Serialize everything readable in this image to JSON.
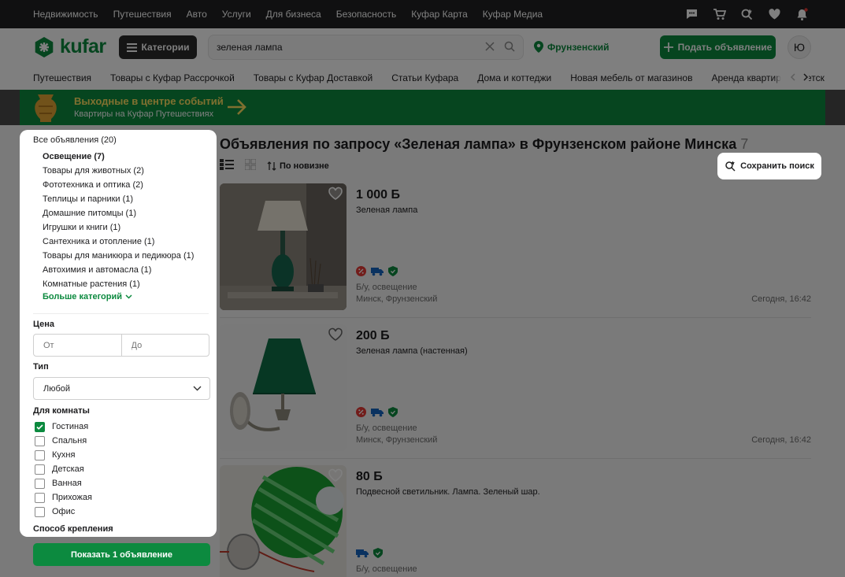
{
  "topnav": {
    "links": [
      "Недвижимость",
      "Путешествия",
      "Авто",
      "Услуги",
      "Для бизнеса",
      "Безопасность",
      "Куфар Карта",
      "Куфар Медиа"
    ],
    "icons": [
      "chat-icon",
      "cart-icon",
      "saved-search-icon",
      "heart-icon",
      "bell-icon"
    ]
  },
  "header": {
    "logo": "kufar",
    "categories_label": "Категории",
    "search_value": "зеленая лампа",
    "location": "Фрунзенский",
    "post_label": "Подать объявление",
    "avatar_letter": "Ю"
  },
  "catrow": [
    "Путешествия",
    "Товары с Куфар Рассрочкой",
    "Товары с Куфар Доставкой",
    "Статьи Куфара",
    "Дома и коттеджи",
    "Новая мебель от магазинов",
    "Аренда квартир",
    "Детск"
  ],
  "banner": {
    "title": "Выходные в центре событий",
    "subtitle": "Квартиры на Куфар Путешествиях"
  },
  "results": {
    "title": "Объявления по запросу «Зеленая лампа» в Фрунзенском районе Минска",
    "count": "7",
    "sort_label": "По новизне",
    "save_search_label": "Сохранить поиск"
  },
  "listings": [
    {
      "price": "1 000 Б",
      "title": "Зеленая лампа",
      "condition": "Б/у, освещение",
      "location": "Минск, Фрунзенский",
      "date": "Сегодня, 16:42"
    },
    {
      "price": "200 Б",
      "title": "Зеленая лампа (настенная)",
      "condition": "Б/у, освещение",
      "location": "Минск, Фрунзенский",
      "date": "Сегодня, 16:42"
    },
    {
      "price": "80 Б",
      "title": "Подвесной светильник. Лампа. Зеленый шар.",
      "condition": "Б/у, освещение",
      "location": "",
      "date": ""
    }
  ],
  "filter": {
    "all_label": "Все объявления (20)",
    "categories": [
      "Освещение (7)",
      "Товары для животных (2)",
      "Фототехника и оптика (2)",
      "Теплицы и парники (1)",
      "Домашние питомцы (1)",
      "Игрушки и книги (1)",
      "Сантехника и отопление (1)",
      "Товары для маникюра и педикюра (1)",
      "Автохимия и автомасла (1)",
      "Комнатные растения (1)"
    ],
    "more_label": "Больше категорий",
    "price_label": "Цена",
    "price_from_placeholder": "От",
    "price_to_placeholder": "До",
    "type_label": "Тип",
    "type_value": "Любой",
    "room_label": "Для комнаты",
    "rooms": [
      {
        "label": "Гостиная",
        "checked": true
      },
      {
        "label": "Спальня",
        "checked": false
      },
      {
        "label": "Кухня",
        "checked": false
      },
      {
        "label": "Детская",
        "checked": false
      },
      {
        "label": "Ванная",
        "checked": false
      },
      {
        "label": "Прихожая",
        "checked": false
      },
      {
        "label": "Офис",
        "checked": false
      }
    ],
    "mount_label": "Способ крепления",
    "show_button": "Показать 1 объявление"
  },
  "colors": {
    "brand_green": "#0c8a3f",
    "banner_title": "#ffe060",
    "topbar": "#202122"
  }
}
